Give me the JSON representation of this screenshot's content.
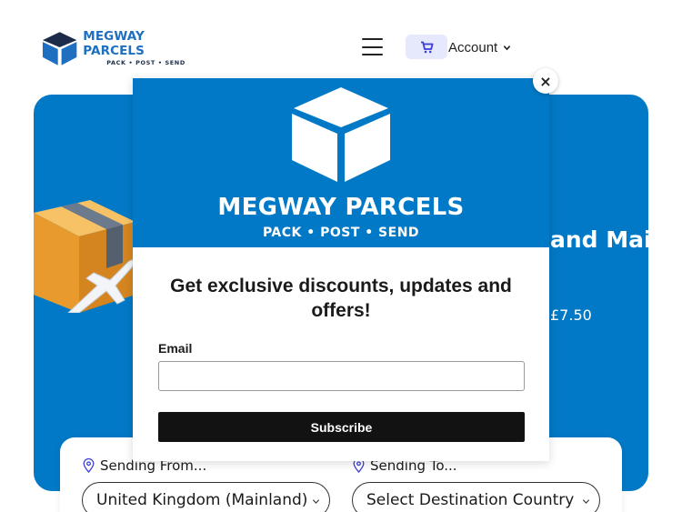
{
  "header": {
    "brand_name": "MEGWAY PARCELS",
    "brand_tagline": "PACK • POST • SEND",
    "account_label": "Account"
  },
  "hero": {
    "title_fragment": "and Mai",
    "price_fragment": "£7.50"
  },
  "booking": {
    "from_label": "Sending From...",
    "from_value": "United Kingdom (Mainland)",
    "to_label": "Sending To...",
    "to_value": "Select Destination Country"
  },
  "modal": {
    "brand_name": "MEGWAY PARCELS",
    "brand_tagline": "PACK • POST • SEND",
    "heading": "Get exclusive discounts, updates and offers!",
    "email_label": "Email",
    "email_value": "",
    "subscribe_label": "Subscribe",
    "close_glyph": "×"
  },
  "colors": {
    "brand_blue": "#0279c6",
    "logo_blue": "#1f6fc0",
    "cart_bg": "#e6e9fb",
    "cart_icon": "#3b3fd4",
    "subscribe_bg": "#121212"
  },
  "icons": [
    "hamburger-icon",
    "cart-icon",
    "chevron-down-icon",
    "location-pin-icon",
    "close-icon",
    "cube-logo-icon"
  ]
}
